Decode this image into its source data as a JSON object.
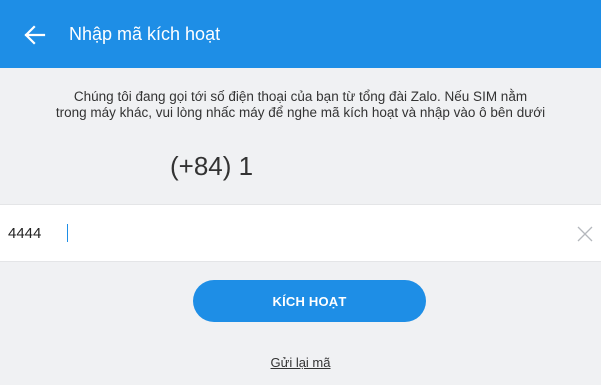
{
  "header": {
    "title": "Nhập mã kích hoạt",
    "back_icon": "arrow-left-icon",
    "background_color": "#1e8ee6"
  },
  "info": {
    "line1": "Chúng tôi đang gọi tới số điện thoại của bạn từ tổng đài Zalo. Nếu SIM nằm",
    "line2": "trong máy khác, vui lòng nhấc máy để nghe mã kích hoạt và nhập vào ô bên dưới"
  },
  "phone": {
    "number": "(+84) 1"
  },
  "code_input": {
    "value": "4444",
    "clear_icon": "close-icon"
  },
  "activate_button": {
    "label": "KÍCH HOẠT",
    "color": "#1e8ee6"
  },
  "resend": {
    "label": "Gửi lại mã"
  }
}
